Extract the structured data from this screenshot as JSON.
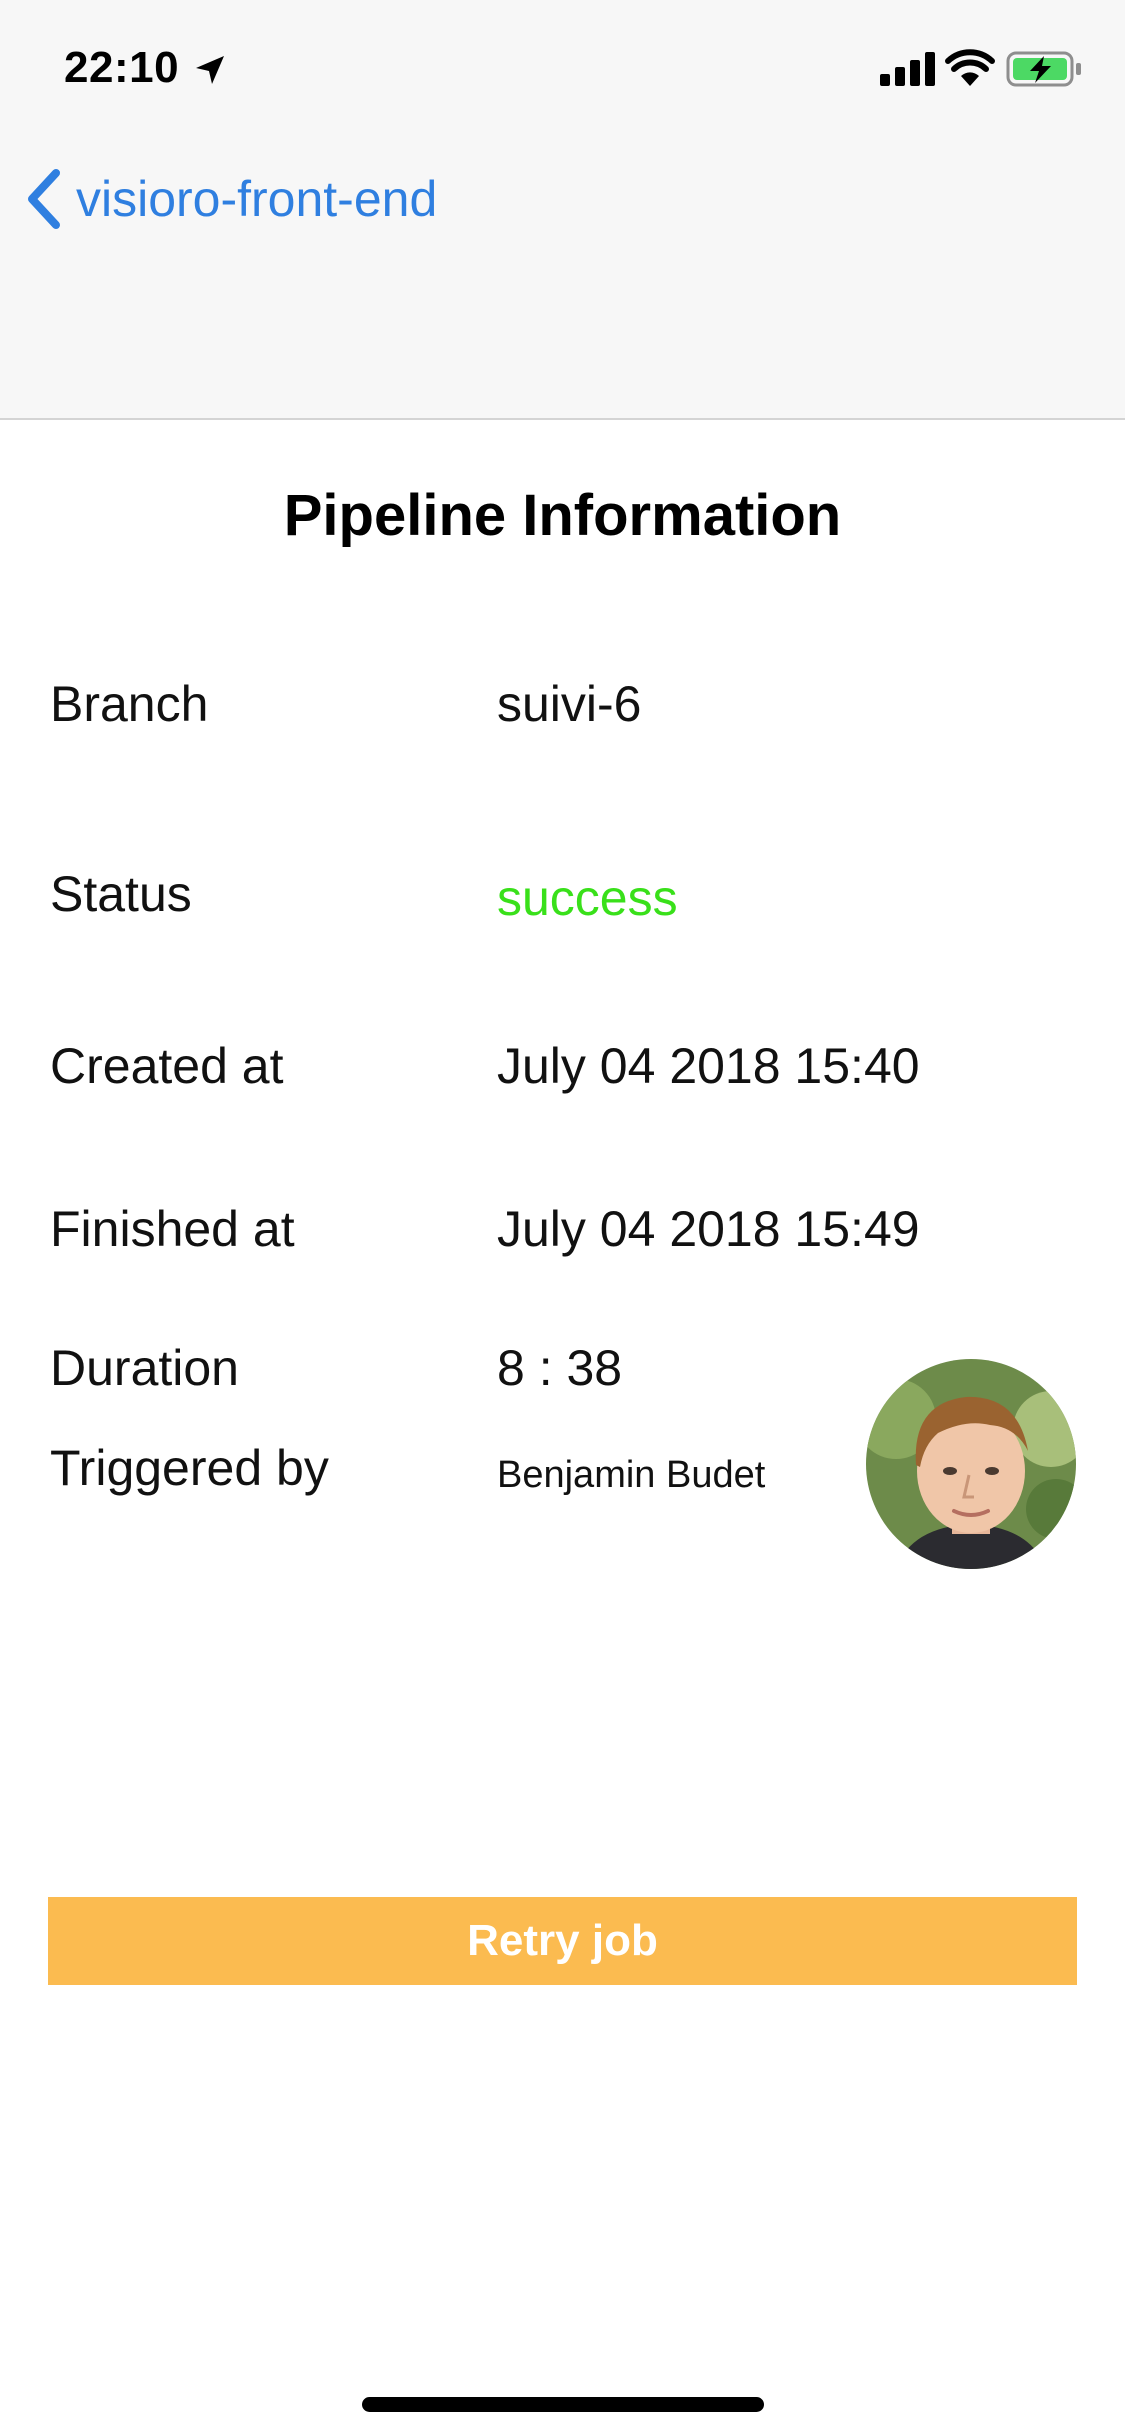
{
  "status_bar": {
    "time": "22:10",
    "icons": [
      "location-arrow-icon",
      "cellular-signal-icon",
      "wifi-icon",
      "battery-charging-icon"
    ]
  },
  "nav": {
    "back_label": "visioro-front-end",
    "back_icon": "chevron-left-icon",
    "accent_color": "#2f7fe0"
  },
  "page": {
    "title": "Pipeline Information"
  },
  "info": {
    "branch": {
      "label": "Branch",
      "value": "suivi-6"
    },
    "status": {
      "label": "Status",
      "value": "success",
      "color": "#39e01a"
    },
    "created": {
      "label": "Created at",
      "value": "July 04 2018 15:40"
    },
    "finished": {
      "label": "Finished at",
      "value": "July 04 2018 15:49"
    },
    "duration": {
      "label": "Duration",
      "value": "8 : 38"
    },
    "triggered": {
      "label": "Triggered by",
      "value": "Benjamin Budet"
    }
  },
  "avatar": {
    "icon": "user-avatar-photo"
  },
  "actions": {
    "retry_label": "Retry job",
    "retry_color": "#fbbb50"
  }
}
